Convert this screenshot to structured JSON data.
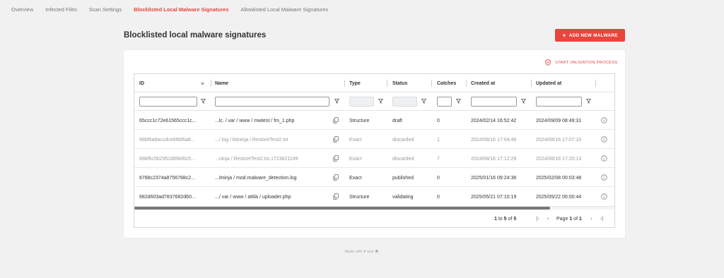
{
  "nav": {
    "tabs": [
      {
        "label": "Overview"
      },
      {
        "label": "Infected Files"
      },
      {
        "label": "Scan Settings"
      },
      {
        "label": "Blocklisted Local Malware Signatures"
      },
      {
        "label": "Allowlisted Local Malware Signatures"
      }
    ],
    "active_index": 3
  },
  "page": {
    "title": "Blocklisted local malware signatures",
    "add_button": "ADD NEW MALWARE",
    "add_icon": "+",
    "validate_button": "START VALIDATION PROCESS",
    "validate_icon": "shield-icon"
  },
  "table": {
    "columns": [
      "ID",
      "Name",
      "Type",
      "Status",
      "Catches",
      "Created at",
      "Updated at"
    ],
    "rows": [
      {
        "id": "65ccc1c72e61565ccc1c...",
        "name": "...lc. / var / www / mwtest / fm_1.php",
        "type": "Structure",
        "status": "draft",
        "catches": "0",
        "created": "2024/02/14 16:52:42",
        "updated": "2024/09/09 08:49:31",
        "dim": false
      },
      {
        "id": "66bf6a8accdce66bf6a8...",
        "name": ".../ log / bitninja / RestoreTest2.txt",
        "type": "Exact",
        "status": "discarded",
        "catches": "1",
        "created": "2024/08/16 17:04:46",
        "updated": "2024/08/16 17:07:10",
        "dim": true
      },
      {
        "id": "66bf6c5b2952d66bf6c5...",
        "name": "...ninja / RestoreTest2.txt.1723821149",
        "type": "Exact",
        "status": "discarded",
        "catches": "7",
        "created": "2024/08/16 17:12:29",
        "updated": "2024/08/16 17:20:13",
        "dim": true
      },
      {
        "id": "6788c2374a8756788c2...",
        "name": "...itninja / mod.malware_detection.log",
        "type": "Exact",
        "status": "published",
        "catches": "0",
        "created": "2025/01/16 09:24:36",
        "updated": "2025/02/08 00:03:48",
        "dim": false
      },
      {
        "id": "682d603ad7837682d60...",
        "name": ".../ var / www / attila / uploader.php",
        "type": "Structure",
        "status": "validating",
        "catches": "0",
        "created": "2025/05/21 07:10:19",
        "updated": "2025/05/22 00:00:44",
        "dim": false
      }
    ],
    "pager": {
      "range_from": "1",
      "range_to_word": "to",
      "range_to": "5",
      "range_of_word": "of",
      "range_total": "5",
      "page_word": "Page",
      "page_current": "1",
      "page_of_word": "of",
      "page_total": "1"
    }
  },
  "footer": {
    "text": "Made with",
    "and": "and"
  },
  "colors": {
    "accent": "#e8453c",
    "background": "#f1f1f1"
  }
}
